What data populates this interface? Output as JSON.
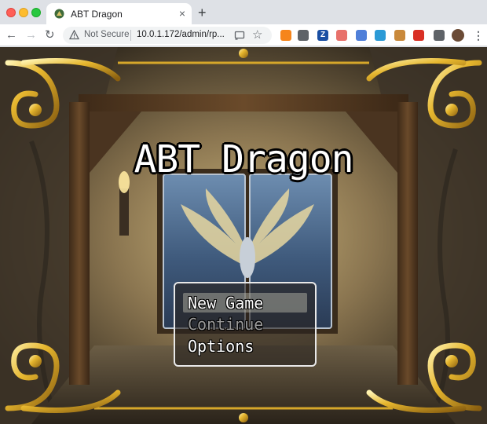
{
  "browser": {
    "tab_title": "ABT Dragon",
    "tab_close": "×",
    "new_tab": "+",
    "nav": {
      "back": "←",
      "forward": "→",
      "reload": "↻"
    },
    "security_label": "Not Secure",
    "url": "10.0.1.172/admin/rp...",
    "star": "☆",
    "menu": "⋮",
    "extensions": [
      {
        "name": "metamask-extension-icon",
        "color": "#f6851b"
      },
      {
        "name": "cube-extension-icon",
        "color": "#5f6368"
      },
      {
        "name": "zotero-extension-icon",
        "color": "#1a4fa3",
        "label": "Z"
      },
      {
        "name": "bookmark-extension-icon",
        "color": "#e8716b"
      },
      {
        "name": "grid-extension-icon",
        "color": "#4f7fd9"
      },
      {
        "name": "pinwheel-extension-icon",
        "color": "#2b9ad6"
      },
      {
        "name": "bear-extension-icon",
        "color": "#c9893b"
      },
      {
        "name": "bolt-extension-icon",
        "color": "#d93025"
      },
      {
        "name": "puzzle-extension-icon",
        "color": "#5f6368"
      },
      {
        "name": "profile-avatar",
        "color": "#6b4b36"
      }
    ]
  },
  "game": {
    "title": "ABT Dragon",
    "menu": {
      "items": [
        "New Game",
        "Continue",
        "Options"
      ],
      "selected_index": 0,
      "disabled": [
        "Continue"
      ]
    }
  }
}
